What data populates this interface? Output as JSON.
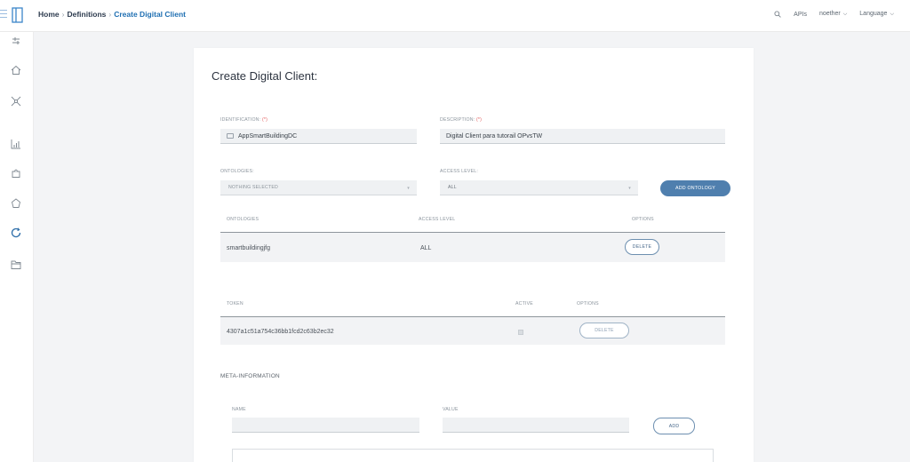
{
  "header": {
    "breadcrumb": [
      "Home",
      "Definitions",
      "Create Digital Client"
    ],
    "search_icon": "search-icon",
    "apis_label": "APIs",
    "user_label": "noether",
    "language_label": "Language"
  },
  "sidebar": {
    "icons": [
      "sliders-icon",
      "home-icon",
      "network-icon",
      "chart-icon",
      "puzzle-icon",
      "cycle-icon",
      "refresh-icon",
      "folder-icon"
    ]
  },
  "form": {
    "title": "Create Digital Client:",
    "identification_label": "IDENTIFICATION:",
    "description_label": "DESCRIPTION:",
    "required_mark": "(*)",
    "identification_value": "AppSmartBuildingDC",
    "description_value": "Digital Client para tutorail OPvsTW",
    "ontologies_label": "ONTOLOGIES:",
    "access_level_label": "ACCESS LEVEL:",
    "ontologies_select": "NOTHING SELECTED",
    "access_level_select": "ALL",
    "add_ontology_label": "ADD ONTOLOGY"
  },
  "ontology_table": {
    "headers": [
      "ONTOLOGIES",
      "ACCESS LEVEL",
      "OPTIONS"
    ],
    "rows": [
      {
        "ontology": "smartbuildingjfg",
        "access": "ALL",
        "action": "DELETE"
      }
    ]
  },
  "token_table": {
    "headers": [
      "TOKEN",
      "ACTIVE",
      "OPTIONS"
    ],
    "rows": [
      {
        "token": "4307a1c51a754c36bb1fcd2c63b2ec32",
        "action": "DELETE"
      }
    ]
  },
  "meta": {
    "title": "META-INFORMATION",
    "name_label": "NAME",
    "value_label": "VALUE",
    "add_label": "ADD"
  }
}
